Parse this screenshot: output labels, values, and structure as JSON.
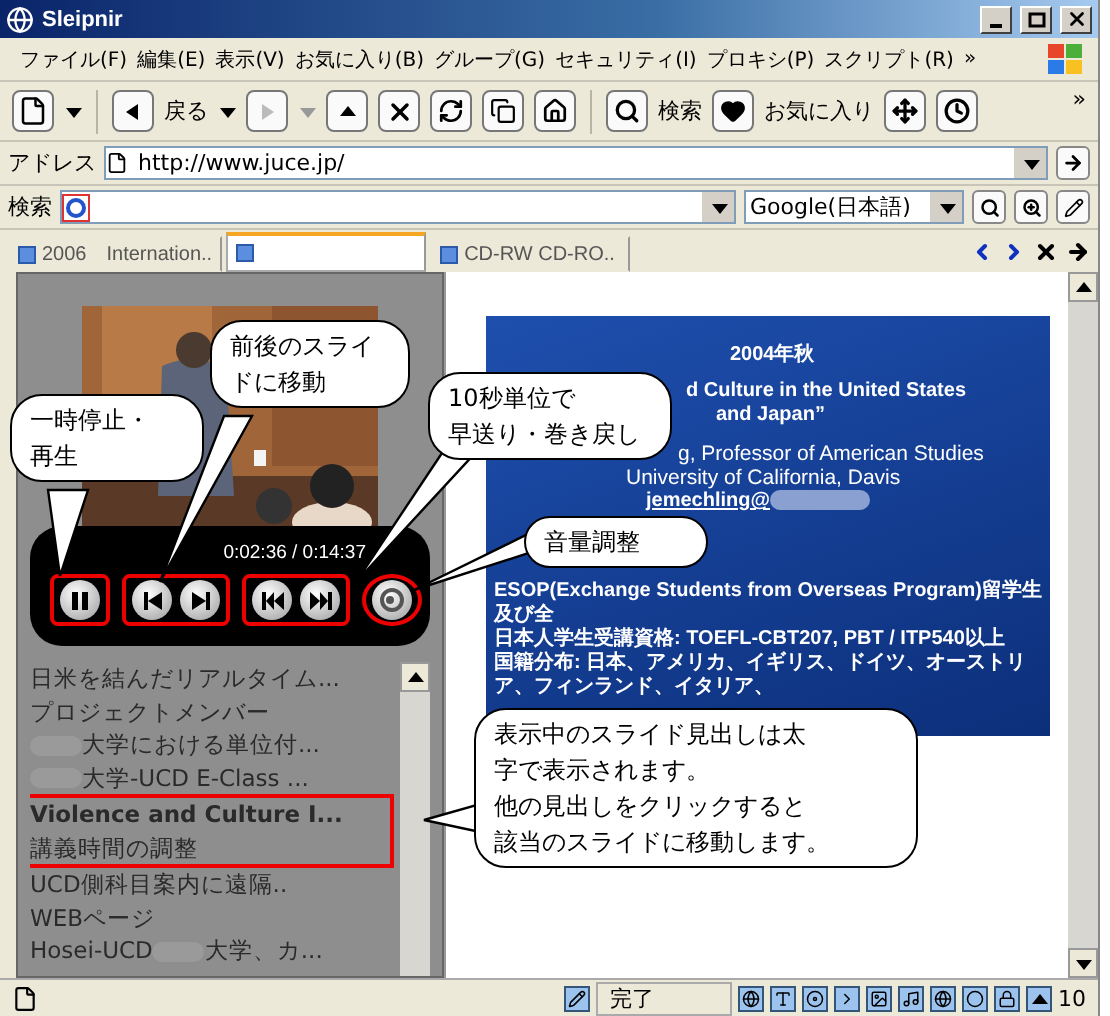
{
  "window": {
    "title": "Sleipnir"
  },
  "menu": [
    "ファイル(F)",
    "編集(E)",
    "表示(V)",
    "お気に入り(B)",
    "グループ(G)",
    "セキュリティ(I)",
    "プロキシ(P)",
    "スクリプト(R)",
    "»"
  ],
  "toolbar": {
    "back_label": "戻る",
    "search_label": "検索",
    "favorites_label": "お気に入り",
    "forward_disabled": true,
    "more": "»"
  },
  "address": {
    "label": "アドレス",
    "value": "http://www.juce.jp/"
  },
  "search": {
    "label": "検索",
    "engine": "Google(日本語)"
  },
  "tabs": [
    {
      "label": "2006　Internation..",
      "selected": false
    },
    {
      "selected": true
    },
    {
      "label": "CD-RW CD-RO..",
      "selected": false
    }
  ],
  "player": {
    "time": "0:02:36 / 0:14:37"
  },
  "slide_list": [
    {
      "text": "日米を結んだリアルタイム...",
      "selected": false,
      "annotated": false,
      "kind": "plain"
    },
    {
      "text": "プロジェクトメンバー",
      "selected": false,
      "annotated": false,
      "kind": "plain"
    },
    {
      "text": "大学における単位付...",
      "selected": false,
      "annotated": false,
      "kind": "redacted_start"
    },
    {
      "text": "大学-UCD E-Class ...",
      "selected": false,
      "annotated": false,
      "kind": "redacted_start"
    },
    {
      "text": "Violence and Culture I...",
      "selected": true,
      "annotated": true,
      "kind": "plain"
    },
    {
      "text": "講義時間の調整",
      "selected": false,
      "annotated": true,
      "kind": "plain"
    },
    {
      "text": "UCD側科目案内に遠隔..",
      "selected": false,
      "annotated": false,
      "kind": "plain"
    },
    {
      "text": "WEBページ",
      "selected": false,
      "annotated": false,
      "kind": "plain"
    },
    {
      "text": "Hosei-UCD",
      "text_after": "大学、カ...",
      "selected": false,
      "annotated": false,
      "kind": "redacted_middle"
    }
  ],
  "slide": {
    "lines": [
      {
        "text": "2004年秋",
        "kind": "heading"
      },
      {
        "text": "d Culture in the United States",
        "kind": "title"
      },
      {
        "text": "and Japan”",
        "kind": "title"
      },
      {
        "text": "g, Professor of American Studies",
        "kind": "author"
      },
      {
        "text": "University of California, Davis",
        "kind": "author"
      },
      {
        "text": "jemechling@",
        "kind": "email"
      },
      {
        "text": "ESOP(Exchange Students from Overseas Program)留学生及び全",
        "kind": "note"
      },
      {
        "text": "日本人学生受講資格: TOEFL-CBT207, PBT / ITP540以上",
        "kind": "note"
      },
      {
        "text": "国籍分布: 日本、アメリカ、イギリス、ドイツ、オーストリア、フィンランド、イタリア、",
        "kind": "note"
      }
    ]
  },
  "callouts": [
    {
      "lines": [
        "一時停止・",
        "再生"
      ]
    },
    {
      "lines": [
        "前後のスライ",
        "ドに移動"
      ]
    },
    {
      "lines": [
        "10秒単位で",
        "早送り・巻き戻し"
      ]
    },
    {
      "lines": [
        "音量調整"
      ]
    },
    {
      "lines": [
        "表示中のスライド見出しは太",
        "字で表示されます。",
        "他の見出しをクリックすると",
        "該当のスライドに移動します。"
      ]
    }
  ],
  "status_bar": {
    "text": "完了",
    "zoom": "10"
  }
}
